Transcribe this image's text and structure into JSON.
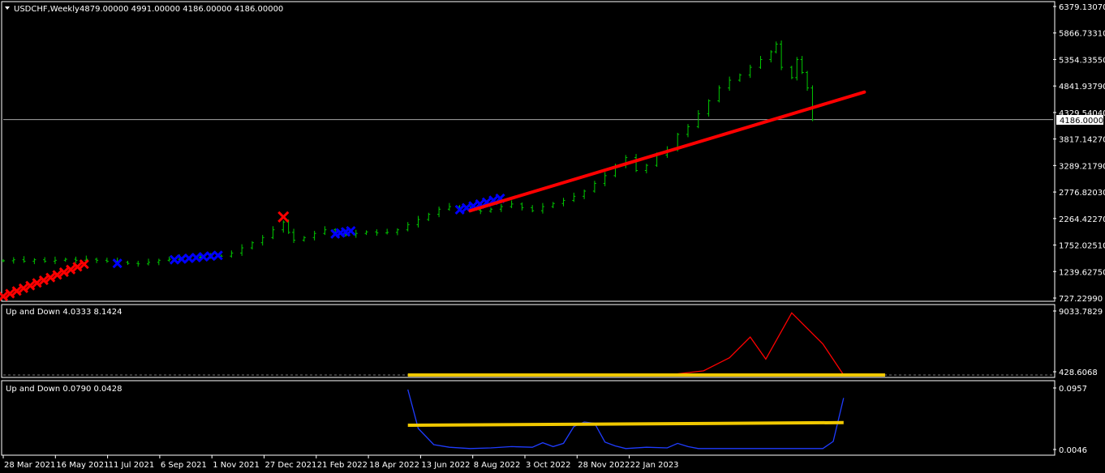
{
  "main": {
    "symbol_label": "USDCHF,Weekly",
    "ohlc_label": "4879.00000 4991.00000 4186.00000 4186.00000",
    "current_price_label": "4186.00000"
  },
  "indicator1": {
    "label": "Up and Down 4.0333 8.1424"
  },
  "indicator2": {
    "label": "Up and Down 0.0790 0.0428"
  },
  "colors": {
    "background": "#000000",
    "candle": "#00c800",
    "trendline": "#ff0000",
    "marker_blue": "#0000ff",
    "marker_red": "#ff0000",
    "ind1_line": "#ff0000",
    "ind2_line": "#1f3cff",
    "level_line": "#f0c800"
  },
  "chart_data": [
    {
      "type": "line",
      "title": "USDCHF,Weekly",
      "x_ticks": [
        "28 Mar 2021",
        "16 May 2021",
        "11 Jul 2021",
        "6 Sep 2021",
        "1 Nov 2021",
        "27 Dec 2021",
        "21 Feb 2022",
        "18 Apr 2022",
        "13 Jun 2022",
        "8 Aug 2022",
        "3 Oct 2022",
        "28 Nov 2022",
        "22 Jan 2023"
      ],
      "y_ticks": [
        "6379.13070",
        "5866.73310",
        "5354.33550",
        "4841.93790",
        "4329.54040",
        "3817.14270",
        "3289.21790",
        "2776.82030",
        "2264.42270",
        "1752.02510",
        "1239.62750",
        "727.22990"
      ],
      "ylim": [
        727.2299,
        6379.1307
      ],
      "current_price": 4186.0,
      "series": [
        {
          "values": [
            {
              "x": 0,
              "y": 1450
            },
            {
              "x": 2,
              "y": 1470
            },
            {
              "x": 4,
              "y": 1440
            },
            {
              "x": 6,
              "y": 1470
            },
            {
              "x": 8,
              "y": 1440
            },
            {
              "x": 10,
              "y": 1460
            },
            {
              "x": 12,
              "y": 1480
            },
            {
              "x": 14,
              "y": 1460
            },
            {
              "x": 16,
              "y": 1480
            },
            {
              "x": 18,
              "y": 1460
            },
            {
              "x": 20,
              "y": 1440
            },
            {
              "x": 22,
              "y": 1420
            },
            {
              "x": 24,
              "y": 1400
            },
            {
              "x": 26,
              "y": 1390
            },
            {
              "x": 28,
              "y": 1420
            },
            {
              "x": 30,
              "y": 1460
            },
            {
              "x": 32,
              "y": 1480
            },
            {
              "x": 34,
              "y": 1500
            },
            {
              "x": 36,
              "y": 1510
            },
            {
              "x": 38,
              "y": 1520
            },
            {
              "x": 40,
              "y": 1530
            },
            {
              "x": 42,
              "y": 1540
            },
            {
              "x": 44,
              "y": 1600
            },
            {
              "x": 46,
              "y": 1700
            },
            {
              "x": 48,
              "y": 1800
            },
            {
              "x": 50,
              "y": 1900
            },
            {
              "x": 52,
              "y": 2050
            },
            {
              "x": 54,
              "y": 2200
            },
            {
              "x": 55,
              "y": 2000
            },
            {
              "x": 56,
              "y": 1850
            },
            {
              "x": 58,
              "y": 1900
            },
            {
              "x": 60,
              "y": 1980
            },
            {
              "x": 62,
              "y": 2050
            },
            {
              "x": 64,
              "y": 2000
            },
            {
              "x": 66,
              "y": 1950
            },
            {
              "x": 68,
              "y": 1980
            },
            {
              "x": 70,
              "y": 2010
            },
            {
              "x": 72,
              "y": 1990
            },
            {
              "x": 74,
              "y": 2000
            },
            {
              "x": 76,
              "y": 2050
            },
            {
              "x": 78,
              "y": 2150
            },
            {
              "x": 80,
              "y": 2250
            },
            {
              "x": 82,
              "y": 2350
            },
            {
              "x": 84,
              "y": 2450
            },
            {
              "x": 86,
              "y": 2500
            },
            {
              "x": 88,
              "y": 2460
            },
            {
              "x": 90,
              "y": 2430
            },
            {
              "x": 92,
              "y": 2410
            },
            {
              "x": 94,
              "y": 2450
            },
            {
              "x": 96,
              "y": 2500
            },
            {
              "x": 98,
              "y": 2550
            },
            {
              "x": 100,
              "y": 2480
            },
            {
              "x": 102,
              "y": 2420
            },
            {
              "x": 104,
              "y": 2500
            },
            {
              "x": 106,
              "y": 2560
            },
            {
              "x": 108,
              "y": 2620
            },
            {
              "x": 110,
              "y": 2700
            },
            {
              "x": 112,
              "y": 2800
            },
            {
              "x": 114,
              "y": 2950
            },
            {
              "x": 116,
              "y": 3100
            },
            {
              "x": 118,
              "y": 3300
            },
            {
              "x": 120,
              "y": 3450
            },
            {
              "x": 122,
              "y": 3200
            },
            {
              "x": 124,
              "y": 3300
            },
            {
              "x": 126,
              "y": 3500
            },
            {
              "x": 128,
              "y": 3600
            },
            {
              "x": 130,
              "y": 3900
            },
            {
              "x": 132,
              "y": 4050
            },
            {
              "x": 134,
              "y": 4300
            },
            {
              "x": 136,
              "y": 4550
            },
            {
              "x": 138,
              "y": 4800
            },
            {
              "x": 140,
              "y": 4950
            },
            {
              "x": 142,
              "y": 5050
            },
            {
              "x": 144,
              "y": 5200
            },
            {
              "x": 146,
              "y": 5350
            },
            {
              "x": 148,
              "y": 5500
            },
            {
              "x": 149,
              "y": 5650
            },
            {
              "x": 150,
              "y": 5200
            },
            {
              "x": 152,
              "y": 5000
            },
            {
              "x": 153,
              "y": 5350
            },
            {
              "x": 154,
              "y": 5100
            },
            {
              "x": 155,
              "y": 4800
            },
            {
              "x": 156,
              "y": 4186
            }
          ]
        }
      ]
    },
    {
      "type": "line",
      "title": "Up and Down 4.0333 8.1424",
      "y_ticks": [
        "9033.7829",
        "428.6068"
      ],
      "ylim": [
        0,
        9500
      ],
      "series": [
        {
          "values": [
            {
              "x": 120,
              "y": 0
            },
            {
              "x": 128,
              "y": 0
            },
            {
              "x": 135,
              "y": 600
            },
            {
              "x": 140,
              "y": 2500
            },
            {
              "x": 144,
              "y": 5500
            },
            {
              "x": 147,
              "y": 2300
            },
            {
              "x": 152,
              "y": 9000
            },
            {
              "x": 158,
              "y": 4500
            },
            {
              "x": 162,
              "y": 0
            },
            {
              "x": 170,
              "y": 0
            }
          ]
        },
        {
          "values": [
            {
              "x": 78,
              "y": 0
            },
            {
              "x": 170,
              "y": 0
            }
          ]
        }
      ]
    },
    {
      "type": "line",
      "title": "Up and Down 0.0790 0.0428",
      "y_ticks": [
        "0.0957",
        "0.0046"
      ],
      "ylim": [
        0,
        0.1
      ],
      "series": [
        {
          "values": [
            {
              "x": 78,
              "y": 0.095
            },
            {
              "x": 80,
              "y": 0.035
            },
            {
              "x": 83,
              "y": 0.01
            },
            {
              "x": 86,
              "y": 0.006
            },
            {
              "x": 90,
              "y": 0.004
            },
            {
              "x": 94,
              "y": 0.005
            },
            {
              "x": 98,
              "y": 0.007
            },
            {
              "x": 102,
              "y": 0.006
            },
            {
              "x": 104,
              "y": 0.013
            },
            {
              "x": 106,
              "y": 0.007
            },
            {
              "x": 108,
              "y": 0.012
            },
            {
              "x": 110,
              "y": 0.038
            },
            {
              "x": 112,
              "y": 0.045
            },
            {
              "x": 114,
              "y": 0.043
            },
            {
              "x": 116,
              "y": 0.014
            },
            {
              "x": 118,
              "y": 0.008
            },
            {
              "x": 120,
              "y": 0.004
            },
            {
              "x": 124,
              "y": 0.006
            },
            {
              "x": 128,
              "y": 0.005
            },
            {
              "x": 130,
              "y": 0.012
            },
            {
              "x": 132,
              "y": 0.007
            },
            {
              "x": 134,
              "y": 0.004
            },
            {
              "x": 140,
              "y": 0.004
            },
            {
              "x": 150,
              "y": 0.004
            },
            {
              "x": 158,
              "y": 0.004
            },
            {
              "x": 160,
              "y": 0.015
            },
            {
              "x": 162,
              "y": 0.082
            }
          ]
        },
        {
          "values": [
            {
              "x": 78,
              "y": 0.04
            },
            {
              "x": 162,
              "y": 0.044
            }
          ]
        }
      ]
    }
  ]
}
